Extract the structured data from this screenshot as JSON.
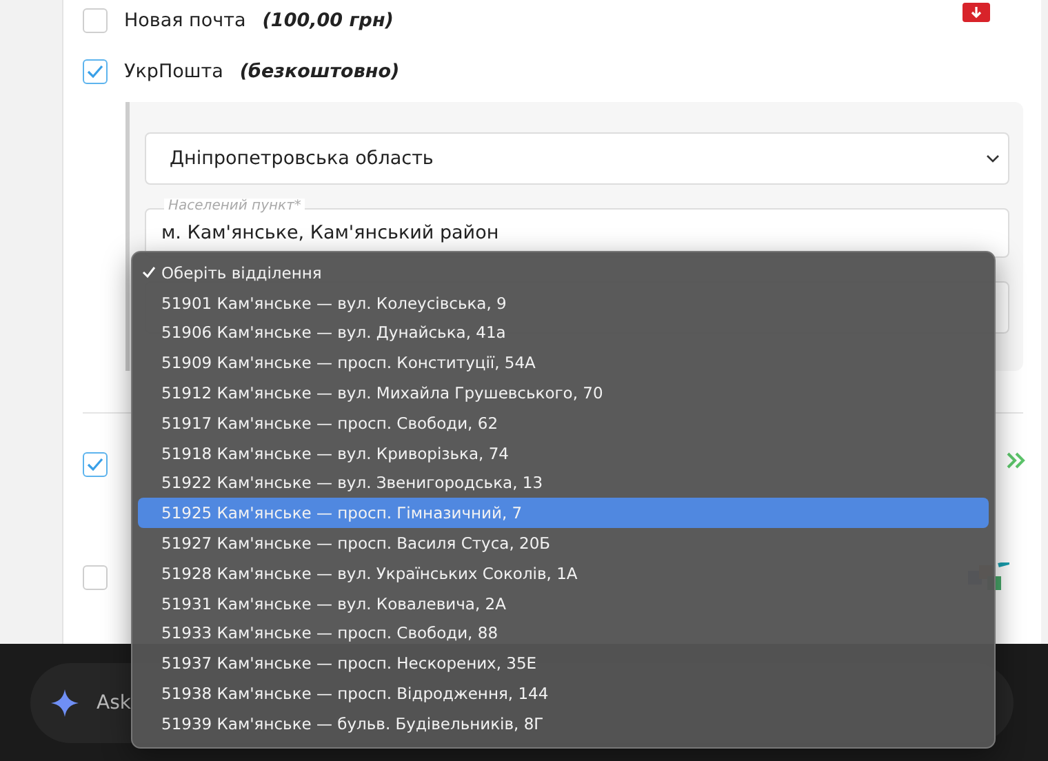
{
  "delivery_options": [
    {
      "kind": "plain",
      "label": "Новая почта",
      "note": "(100,00 грн)",
      "checked": false
    },
    {
      "kind": "form",
      "label": "УкрПошта",
      "note": "(безкоштовно)",
      "checked": true,
      "region": {
        "value": "Дніпропетровська область"
      },
      "settlement": {
        "placeholder": "Населений пункт*",
        "value": "м. Кам'янське, Кам'янський район"
      }
    },
    {
      "kind": "logo",
      "checked": true
    },
    {
      "kind": "logo2",
      "checked": false
    }
  ],
  "branch_menu": [
    {
      "label": "Оберіть відділення",
      "selected": true,
      "hovered": false
    },
    {
      "label": "51901 Кам'янське — вул. Колеусівська, 9",
      "selected": false,
      "hovered": false
    },
    {
      "label": "51906 Кам'янське — вул. Дунайська, 41а",
      "selected": false,
      "hovered": false
    },
    {
      "label": "51909 Кам'янське — просп. Конституції, 54А",
      "selected": false,
      "hovered": false
    },
    {
      "label": "51912 Кам'янське — вул. Михайла Грушевського, 70",
      "selected": false,
      "hovered": false
    },
    {
      "label": "51917 Кам'янське — просп. Свободи, 62",
      "selected": false,
      "hovered": false
    },
    {
      "label": "51918 Кам'янське — вул. Криворізька, 74",
      "selected": false,
      "hovered": false
    },
    {
      "label": "51922 Кам'янське — вул. Звенигородська, 13",
      "selected": false,
      "hovered": false
    },
    {
      "label": "51925 Кам'янське — просп. Гімназичний, 7",
      "selected": false,
      "hovered": true
    },
    {
      "label": "51927 Кам'янське — просп. Василя Стуса, 20Б",
      "selected": false,
      "hovered": false
    },
    {
      "label": "51928 Кам'янське — вул. Українських Соколів, 1А",
      "selected": false,
      "hovered": false
    },
    {
      "label": "51931 Кам'янське — вул. Ковалевича, 2А",
      "selected": false,
      "hovered": false
    },
    {
      "label": "51933 Кам'янське — просп. Свободи, 88",
      "selected": false,
      "hovered": false
    },
    {
      "label": "51937 Кам'янське — просп. Нескорених, 35Е",
      "selected": false,
      "hovered": false
    },
    {
      "label": "51938 Кам'янське — просп. Відродження, 144",
      "selected": false,
      "hovered": false
    },
    {
      "label": "51939 Кам'янське — бульв. Будівельників, 8Г",
      "selected": false,
      "hovered": false
    }
  ],
  "assistant_bar": {
    "placeholder": "Ask"
  }
}
